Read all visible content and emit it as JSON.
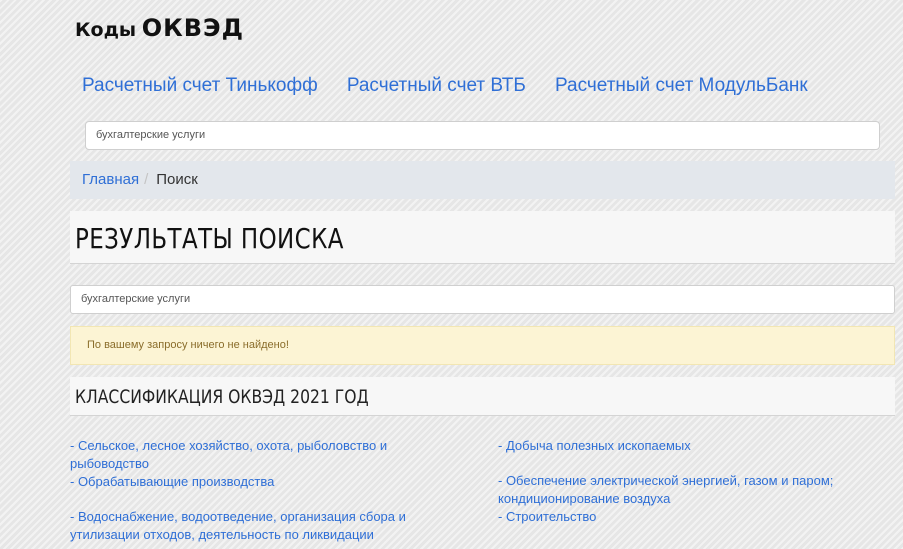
{
  "logo": {
    "part1": "Коды",
    "part2": "ОКВЭД"
  },
  "nav": [
    {
      "label": "Расчетный счет Тинькофф"
    },
    {
      "label": "Расчетный счет ВТБ"
    },
    {
      "label": "Расчетный счет МодульБанк"
    }
  ],
  "search": {
    "value": "бухгалтерские услуги"
  },
  "breadcrumb": {
    "home": "Главная",
    "separator": "/",
    "current": "Поиск"
  },
  "page_title": "РЕЗУЛЬТАТЫ ПОИСКА",
  "query": {
    "value": "бухгалтерские услуги"
  },
  "alert": {
    "message": "По вашему запросу ничего не найдено!"
  },
  "classification": {
    "title": "КЛАССИФИКАЦИЯ ОКВЭД 2021 ГОД",
    "left": [
      "- Сельское, лесное хозяйство, охота, рыболовство и рыбоводство",
      "- Обрабатывающие производства",
      "- Водоснабжение, водоотведение, организация сбора и утилизации отходов, деятельность по ликвидации"
    ],
    "right": [
      "- Добыча полезных ископаемых",
      "- Обеспечение электрической энергией, газом и паром; кондиционирование воздуха",
      "- Строительство"
    ]
  },
  "colors": {
    "link": "#2f6fd6",
    "alert_bg": "#fcf4d4",
    "alert_text": "#8a6d2b",
    "breadcrumb_bg": "#e3e7ec"
  }
}
